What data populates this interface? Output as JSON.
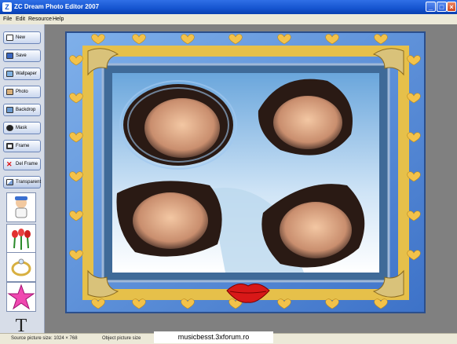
{
  "window": {
    "title": "ZC Dream Photo Editor 2007",
    "icon": "app-icon",
    "controls": [
      "minimize",
      "maximize",
      "close"
    ]
  },
  "menu": {
    "items": [
      "File",
      "Edit",
      "Resource",
      "Help"
    ]
  },
  "toolbar": {
    "buttons": [
      {
        "label": "New",
        "icon": "new-document-icon"
      },
      {
        "label": "Save",
        "icon": "save-icon"
      },
      {
        "label": "Wallpaper",
        "icon": "wallpaper-icon"
      },
      {
        "label": "Photo",
        "icon": "photo-icon"
      },
      {
        "label": "Backdrop",
        "icon": "backdrop-icon"
      },
      {
        "label": "Mask",
        "icon": "mask-icon"
      },
      {
        "label": "Frame",
        "icon": "frame-icon"
      },
      {
        "label": "Del Frame",
        "icon": "delete-icon"
      },
      {
        "label": "Transparent",
        "icon": "transparent-icon"
      }
    ]
  },
  "tools": [
    {
      "name": "baby-clipart",
      "icon": "baby-clipart-icon"
    },
    {
      "name": "tulips-clipart",
      "icon": "tulips-clipart-icon"
    },
    {
      "name": "ring-clipart",
      "icon": "ring-clipart-icon"
    },
    {
      "name": "star-clipart",
      "icon": "star-clipart-icon"
    },
    {
      "name": "text-tool",
      "glyph": "T"
    }
  ],
  "status": {
    "source_size": "Source picture size: 1024 × 768",
    "object_size": "Object picture size"
  },
  "watermark": "musicbesst.3xforum.ro",
  "colors": {
    "titlebar": "#1554cf",
    "frame_blue": "#4a84d6",
    "frame_gold": "#e6c04a",
    "heart": "#f3c24a",
    "lips": "#d81818",
    "sky": "#6aa6dc",
    "canvas_bg": "#808080"
  }
}
